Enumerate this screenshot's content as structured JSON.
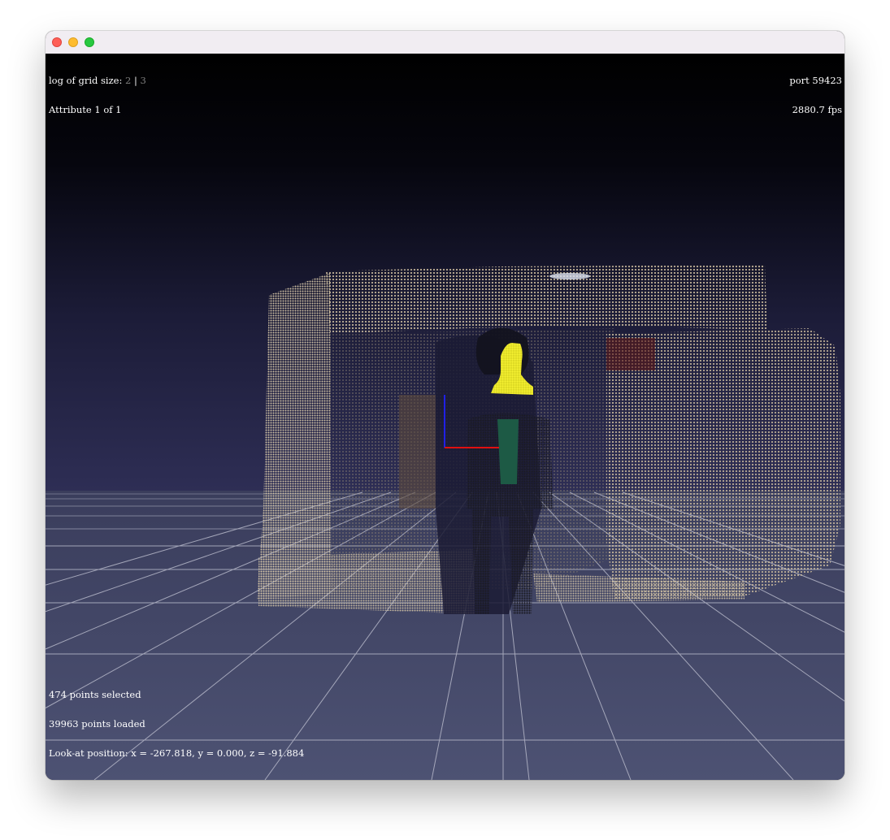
{
  "window": {
    "controls": [
      "close",
      "minimize",
      "maximize"
    ]
  },
  "hud": {
    "grid_label": "log of grid size:",
    "grid_value_inactive": "2",
    "grid_separator": "|",
    "grid_value_active": "3",
    "attribute": "Attribute 1 of 1",
    "port": "port 59423",
    "fps": "2880.7 fps",
    "selected": "474 points selected",
    "loaded": "39963 points loaded",
    "look_at": "Look-at position: x = -267.818, y = 0.000, z = -91.884"
  },
  "colors": {
    "sky_top": "#000000",
    "sky_horizon": "#29294f",
    "floor": "#454a6a",
    "grid_line": "#b5b7c8",
    "points": "#c9b89a",
    "selection": "#f2ee2a",
    "axis_x": "#e01010",
    "axis_y": "#2020e6"
  }
}
